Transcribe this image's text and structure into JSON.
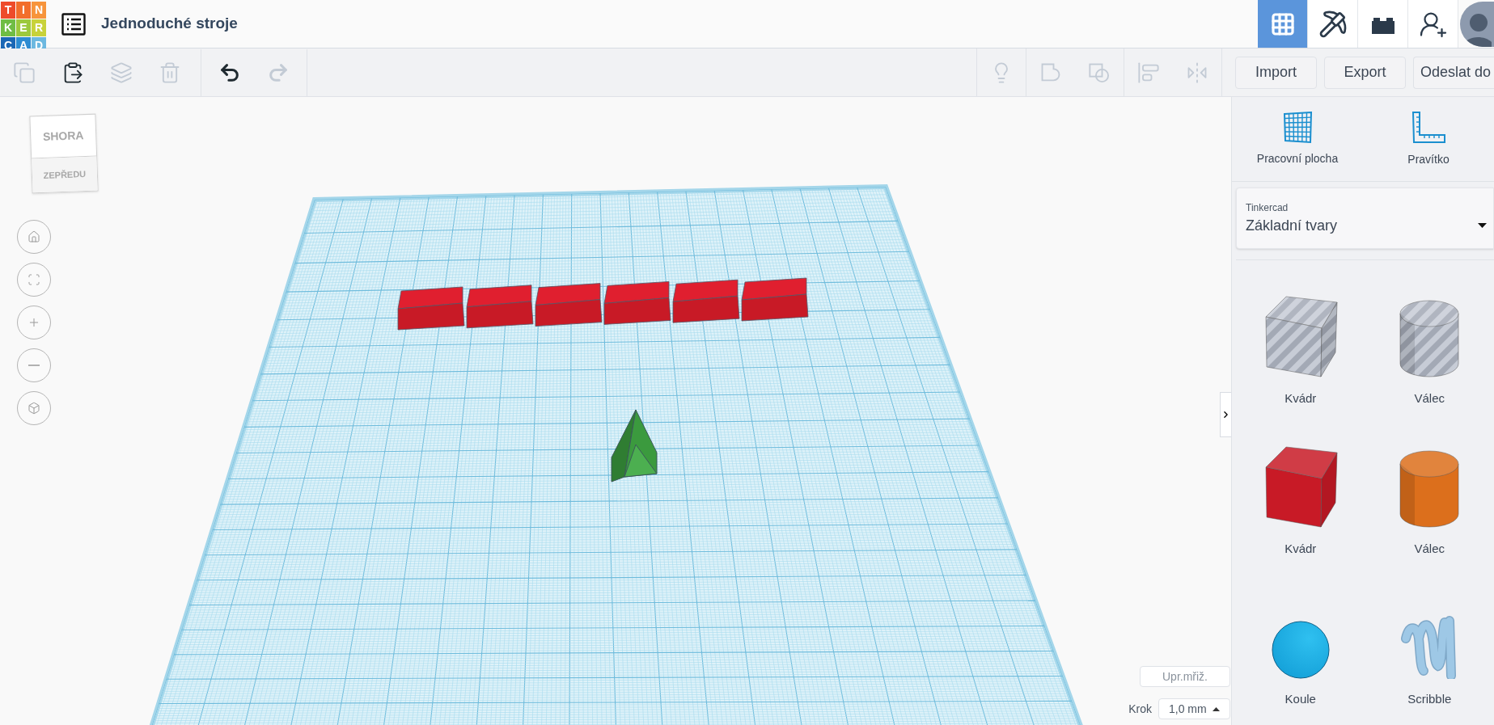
{
  "header": {
    "logo": [
      {
        "letter": "T",
        "color": "#ee4b2b"
      },
      {
        "letter": "I",
        "color": "#f26e2c"
      },
      {
        "letter": "N",
        "color": "#f7943b"
      },
      {
        "letter": "K",
        "color": "#6fbd44"
      },
      {
        "letter": "E",
        "color": "#9cc93d"
      },
      {
        "letter": "R",
        "color": "#c8d23a"
      },
      {
        "letter": "C",
        "color": "#1a67b5"
      },
      {
        "letter": "A",
        "color": "#2d8cd2"
      },
      {
        "letter": "D",
        "color": "#6cb8e0"
      }
    ],
    "title": "Jednoduché stroje",
    "nav": [
      {
        "kind": "grid",
        "selected": true
      },
      {
        "kind": "pickaxe",
        "selected": false
      },
      {
        "kind": "bricks",
        "selected": false
      },
      {
        "kind": "invite",
        "selected": false
      }
    ]
  },
  "toolbar": {
    "edit": [
      {
        "kind": "copy",
        "disabled": true
      },
      {
        "kind": "paste",
        "disabled": false
      },
      {
        "kind": "duplicate",
        "disabled": true
      },
      {
        "kind": "delete",
        "disabled": true
      }
    ],
    "history": [
      {
        "kind": "undo",
        "disabled": false
      },
      {
        "kind": "redo",
        "disabled": true
      }
    ],
    "tools": [
      {
        "kind": "notes",
        "disabled": true
      },
      {
        "kind": "group",
        "disabled": true
      },
      {
        "kind": "ungroup",
        "disabled": true
      },
      {
        "kind": "align",
        "disabled": true
      },
      {
        "kind": "mirror",
        "disabled": true
      }
    ],
    "buttons": [
      "Import",
      "Export",
      "Odeslat do"
    ]
  },
  "view_cube": {
    "top": "SHORA",
    "front": "ZEPŘEDU"
  },
  "view_controls": [
    {
      "kind": "home"
    },
    {
      "kind": "fit"
    },
    {
      "kind": "zoom-in"
    },
    {
      "kind": "zoom-out"
    },
    {
      "kind": "perspective"
    }
  ],
  "grid_controls": {
    "edit_grid": "Upr.mřiž.",
    "snap_label": "Krok",
    "snap_value": "1,0 mm"
  },
  "panel": {
    "tools": [
      {
        "kind": "workplane",
        "label": "Pracovní plocha"
      },
      {
        "kind": "ruler",
        "label": "Pravítko"
      }
    ],
    "library": {
      "label": "Tinkercad",
      "value": "Základní tvary"
    },
    "shapes": [
      {
        "kind": "box",
        "name": "Kvádr",
        "hole": true,
        "color": "#b9bec8"
      },
      {
        "kind": "cylinder",
        "name": "Válec",
        "hole": true,
        "color": "#b9bec8"
      },
      {
        "kind": "box",
        "name": "Kvádr",
        "hole": false,
        "color": "#c81a26"
      },
      {
        "kind": "cylinder",
        "name": "Válec",
        "hole": false,
        "color": "#dc6f1c"
      },
      {
        "kind": "sphere",
        "name": "Koule",
        "hole": false,
        "color": "#14a0d8"
      },
      {
        "kind": "scribble",
        "name": "Scribble",
        "hole": false,
        "color": "#9ec8e6"
      }
    ]
  }
}
